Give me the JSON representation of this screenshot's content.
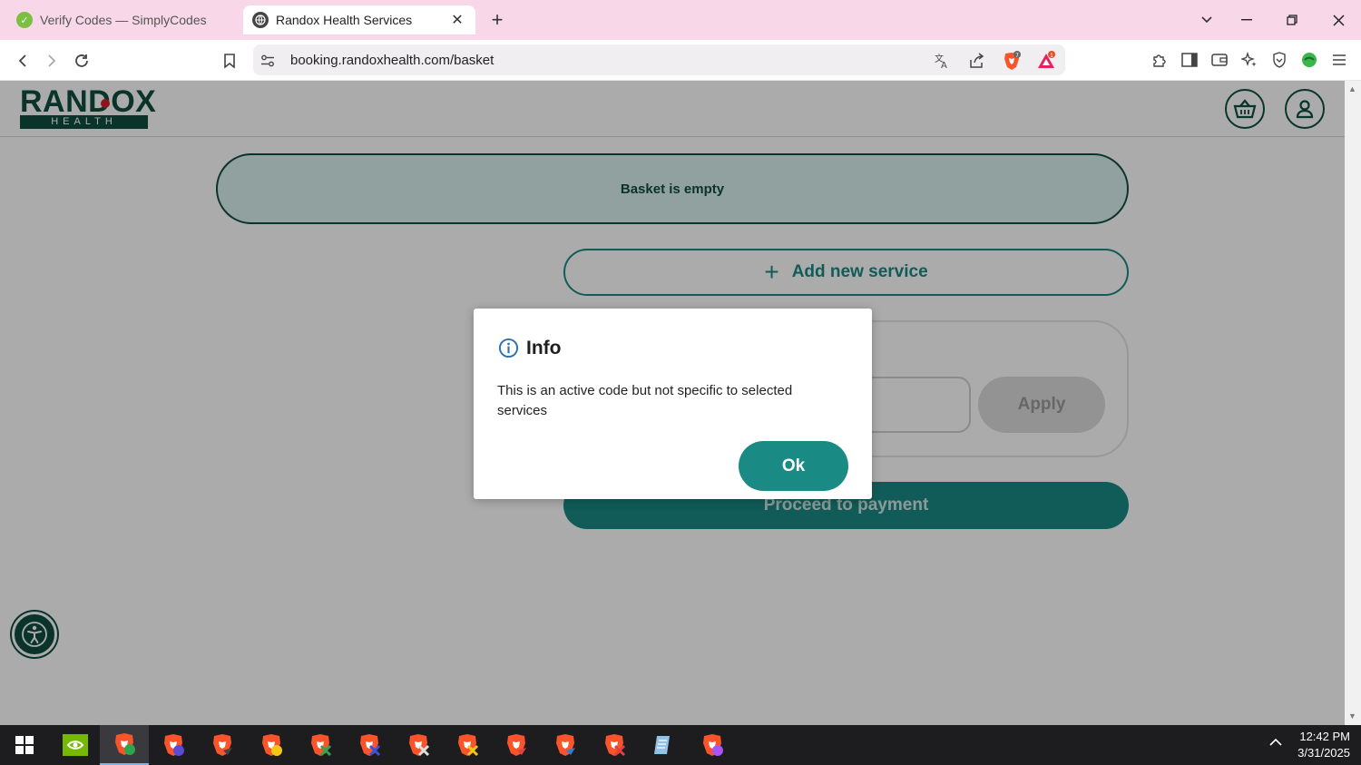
{
  "browser": {
    "tabs": [
      {
        "title": "Verify Codes — SimplyCodes",
        "active": false
      },
      {
        "title": "Randox Health Services",
        "active": true
      }
    ],
    "url": "booking.randoxhealth.com/basket",
    "shield_count": "7",
    "rewards_count": "1"
  },
  "site": {
    "logo_main": "RANDOX",
    "logo_sub": "HEALTH"
  },
  "basket": {
    "empty_message": "Basket is empty",
    "add_service_label": "Add new service",
    "apply_label": "Apply",
    "proceed_label": "Proceed to payment"
  },
  "dialog": {
    "title": "Info",
    "message": "This is an active code but not specific to selected services",
    "ok_label": "Ok"
  },
  "taskbar": {
    "time": "12:42 PM",
    "date": "3/31/2025"
  },
  "colors": {
    "brand_dark": "#0f4d3f",
    "brand_teal": "#1a8a84",
    "tab_strip": "#f8d7e8"
  }
}
